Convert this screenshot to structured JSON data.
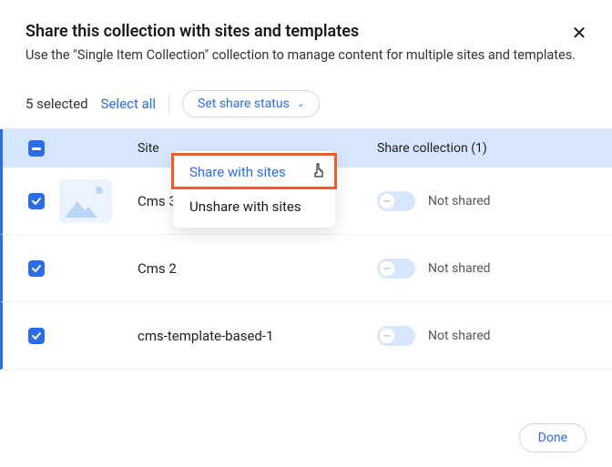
{
  "header": {
    "title": "Share this collection with sites and templates",
    "subtitle": "Use the \"Single Item Collection\" collection to manage content for multiple sites and templates."
  },
  "toolbar": {
    "selected_text": "5 selected",
    "select_all_label": "Select all",
    "share_status_label": "Set share status"
  },
  "dropdown": {
    "share_label": "Share with sites",
    "unshare_label": "Unshare with sites"
  },
  "columns": {
    "site": "Site",
    "share": "Share collection (1)"
  },
  "rows": [
    {
      "name": "Cms 3",
      "share_status": "Not shared"
    },
    {
      "name": "Cms 2",
      "share_status": "Not shared"
    },
    {
      "name": "cms-template-based-1",
      "share_status": "Not shared"
    }
  ],
  "footer": {
    "done_label": "Done"
  }
}
